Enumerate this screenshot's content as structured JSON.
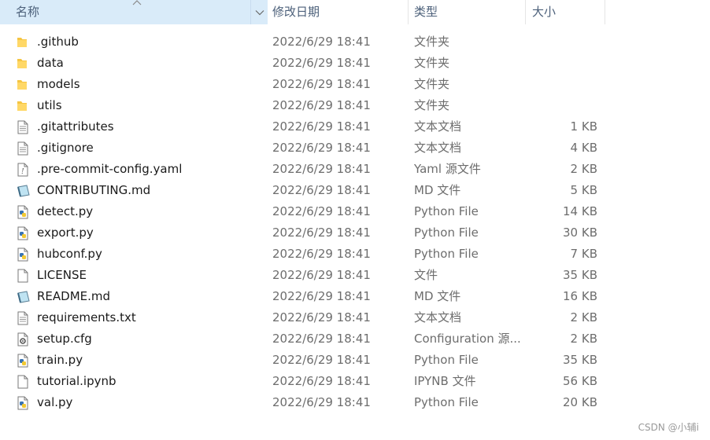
{
  "header": {
    "name_label": "名称",
    "date_label": "修改日期",
    "type_label": "类型",
    "size_label": "大小"
  },
  "files": [
    {
      "name": ".github",
      "date": "2022/6/29 18:41",
      "type": "文件夹",
      "size": "",
      "icon": "folder-icon"
    },
    {
      "name": "data",
      "date": "2022/6/29 18:41",
      "type": "文件夹",
      "size": "",
      "icon": "folder-icon"
    },
    {
      "name": "models",
      "date": "2022/6/29 18:41",
      "type": "文件夹",
      "size": "",
      "icon": "folder-icon"
    },
    {
      "name": "utils",
      "date": "2022/6/29 18:41",
      "type": "文件夹",
      "size": "",
      "icon": "folder-icon"
    },
    {
      "name": ".gitattributes",
      "date": "2022/6/29 18:41",
      "type": "文本文档",
      "size": "1 KB",
      "icon": "text-file-icon"
    },
    {
      "name": ".gitignore",
      "date": "2022/6/29 18:41",
      "type": "文本文档",
      "size": "4 KB",
      "icon": "text-file-icon"
    },
    {
      "name": ".pre-commit-config.yaml",
      "date": "2022/6/29 18:41",
      "type": "Yaml 源文件",
      "size": "2 KB",
      "icon": "yaml-file-icon"
    },
    {
      "name": "CONTRIBUTING.md",
      "date": "2022/6/29 18:41",
      "type": "MD 文件",
      "size": "5 KB",
      "icon": "markdown-file-icon"
    },
    {
      "name": "detect.py",
      "date": "2022/6/29 18:41",
      "type": "Python File",
      "size": "14 KB",
      "icon": "python-file-icon"
    },
    {
      "name": "export.py",
      "date": "2022/6/29 18:41",
      "type": "Python File",
      "size": "30 KB",
      "icon": "python-file-icon"
    },
    {
      "name": "hubconf.py",
      "date": "2022/6/29 18:41",
      "type": "Python File",
      "size": "7 KB",
      "icon": "python-file-icon"
    },
    {
      "name": "LICENSE",
      "date": "2022/6/29 18:41",
      "type": "文件",
      "size": "35 KB",
      "icon": "blank-file-icon"
    },
    {
      "name": "README.md",
      "date": "2022/6/29 18:41",
      "type": "MD 文件",
      "size": "16 KB",
      "icon": "markdown-file-icon"
    },
    {
      "name": "requirements.txt",
      "date": "2022/6/29 18:41",
      "type": "文本文档",
      "size": "2 KB",
      "icon": "text-file-icon"
    },
    {
      "name": "setup.cfg",
      "date": "2022/6/29 18:41",
      "type": "Configuration 源...",
      "size": "2 KB",
      "icon": "config-file-icon"
    },
    {
      "name": "train.py",
      "date": "2022/6/29 18:41",
      "type": "Python File",
      "size": "35 KB",
      "icon": "python-file-icon"
    },
    {
      "name": "tutorial.ipynb",
      "date": "2022/6/29 18:41",
      "type": "IPYNB 文件",
      "size": "56 KB",
      "icon": "blank-file-icon"
    },
    {
      "name": "val.py",
      "date": "2022/6/29 18:41",
      "type": "Python File",
      "size": "20 KB",
      "icon": "python-file-icon"
    }
  ],
  "watermark": "CSDN @小辅i"
}
